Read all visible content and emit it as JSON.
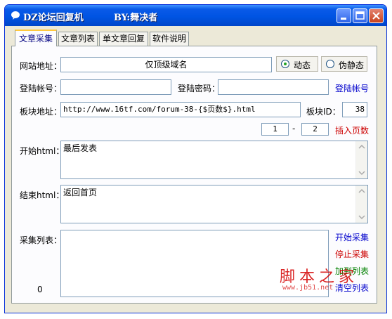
{
  "window": {
    "title": "DZ论坛回复机",
    "author": "BY:舞决者"
  },
  "tabs": [
    {
      "label": "文章采集",
      "active": true
    },
    {
      "label": "文章列表"
    },
    {
      "label": "单文章回复"
    },
    {
      "label": "软件说明"
    }
  ],
  "form": {
    "site_label": "网站地址：",
    "site_value": "仅顶级域名",
    "radio_dynamic": "动态",
    "radio_static": "伪静态",
    "account_label": "登陆帐号：",
    "account_value": "",
    "password_label": "登陆密码：",
    "password_value": "",
    "login_link": "登陆帐号",
    "board_label": "板块地址：",
    "board_value": "http://www.16tf.com/forum-38-{$页数$}.html",
    "board_id_label": "板块ID：",
    "board_id_value": "38",
    "page_from": "1",
    "page_dash": "-",
    "page_to": "2",
    "insert_pages_link": "插入页数",
    "start_html_label": "开始html：",
    "start_html_value": "最后发表",
    "end_html_label": "结束html：",
    "end_html_value": "返回首页",
    "collect_list_label": "采集列表：",
    "collect_count": "0"
  },
  "actions": {
    "start": "开始采集",
    "stop": "停止采集",
    "add_list": "加到列表",
    "clear_list": "清空列表"
  },
  "watermark": {
    "text": "脚本之家",
    "url": "www.jb51.net"
  },
  "colors": {
    "titlebar": "#0054e3",
    "link_blue": "#0000cc",
    "link_red": "#cc0000",
    "link_green": "#008000",
    "tab_highlight": "#ffc83c"
  }
}
